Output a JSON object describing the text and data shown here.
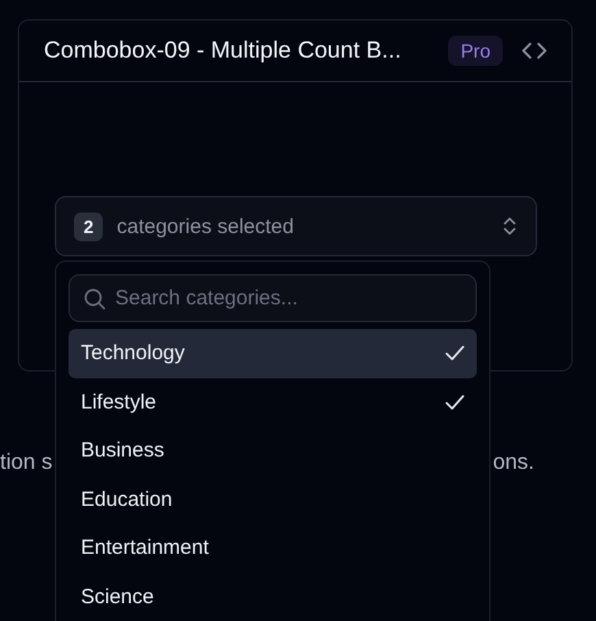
{
  "card": {
    "title": "Combobox-09 - Multiple Count B...",
    "badge": "Pro"
  },
  "combobox": {
    "count": "2",
    "label": "categories selected"
  },
  "description": {
    "left_fragment": "tion s",
    "right_fragment": "ons."
  },
  "dropdown": {
    "search": {
      "placeholder": "Search categories..."
    },
    "items": [
      {
        "label": "Technology",
        "checked": true,
        "highlighted": true
      },
      {
        "label": "Lifestyle",
        "checked": true,
        "highlighted": false
      },
      {
        "label": "Business",
        "checked": false,
        "highlighted": false
      },
      {
        "label": "Education",
        "checked": false,
        "highlighted": false
      },
      {
        "label": "Entertainment",
        "checked": false,
        "highlighted": false
      },
      {
        "label": "Science",
        "checked": false,
        "highlighted": false
      }
    ]
  }
}
